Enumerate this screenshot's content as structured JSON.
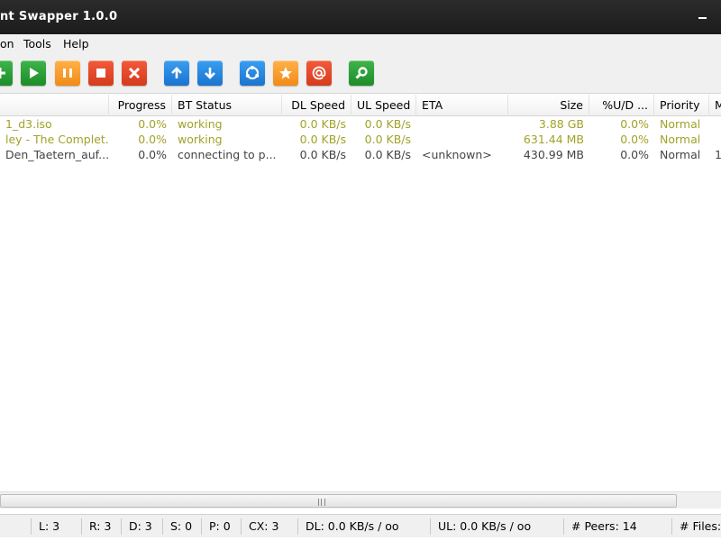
{
  "window": {
    "title": "nt Swapper 1.0.0"
  },
  "menu": [
    "on",
    "Tools",
    "Help"
  ],
  "toolbar": {
    "buttons": [
      {
        "name": "add-button",
        "icon": "add-icon",
        "color": "green"
      },
      {
        "name": "start-button",
        "icon": "play-icon",
        "color": "green"
      },
      {
        "name": "pause-button",
        "icon": "pause-icon",
        "color": "orange"
      },
      {
        "name": "stop-button",
        "icon": "stop-icon",
        "color": "red"
      },
      {
        "name": "remove-button",
        "icon": "close-icon",
        "color": "red"
      },
      {
        "name": "move-up-button",
        "icon": "arrow-up-icon",
        "color": "blue"
      },
      {
        "name": "move-down-button",
        "icon": "arrow-down-icon",
        "color": "blue"
      },
      {
        "name": "share-button",
        "icon": "share-icon",
        "color": "blue"
      },
      {
        "name": "favorite-button",
        "icon": "star-icon",
        "color": "orange"
      },
      {
        "name": "email-button",
        "icon": "at-icon",
        "color": "red"
      },
      {
        "name": "search-button",
        "icon": "search-icon",
        "color": "green"
      }
    ]
  },
  "columns": [
    "",
    "Progress",
    "BT Status",
    "DL Speed",
    "UL Speed",
    "ETA",
    "Size",
    "%U/D ...",
    "Priority",
    "M"
  ],
  "rows": [
    {
      "name": "1_d3.iso",
      "progress": "0.0%",
      "status": "working",
      "dl": "0.0 KB/s",
      "ul": "0.0 KB/s",
      "eta": "",
      "size": "3.88 GB",
      "ud": "0.0%",
      "priority": "Normal",
      "extra": "",
      "state": "active"
    },
    {
      "name": "ley - The Complet...",
      "progress": "0.0%",
      "status": "working",
      "dl": "0.0 KB/s",
      "ul": "0.0 KB/s",
      "eta": "",
      "size": "631.44 MB",
      "ud": "0.0%",
      "priority": "Normal",
      "extra": "",
      "state": "active"
    },
    {
      "name": "Den_Taetern_auf...",
      "progress": "0.0%",
      "status": "connecting to p...",
      "dl": "0.0 KB/s",
      "ul": "0.0 KB/s",
      "eta": "<unknown>",
      "size": "430.99 MB",
      "ud": "0.0%",
      "priority": "Normal",
      "extra": "1",
      "state": "idle"
    }
  ],
  "status": {
    "l": "L: 3",
    "r": "R: 3",
    "d": "D: 3",
    "s": "S: 0",
    "p": "P: 0",
    "cx": "CX: 3",
    "dl": "DL: 0.0 KB/s / oo",
    "ul": "UL: 0.0 KB/s / oo",
    "peers": "# Peers: 14",
    "files": "# Files:"
  },
  "colors": {
    "active_text": "#a2a22a",
    "titlebar": "#1f1f1f"
  }
}
